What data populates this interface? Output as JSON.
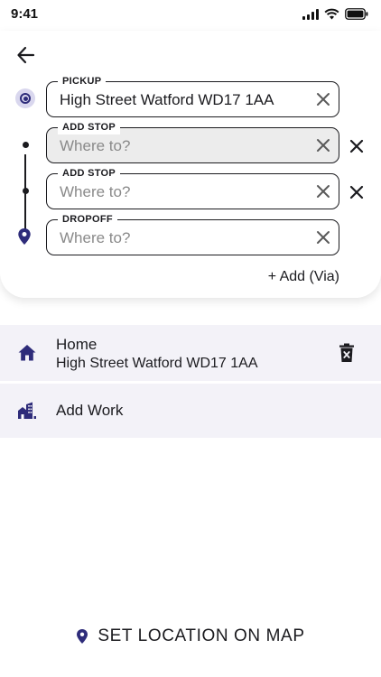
{
  "status_bar": {
    "time": "9:41"
  },
  "route": {
    "pickup": {
      "label": "PICKUP",
      "value": "High Street Watford WD17 1AA",
      "placeholder": "Where to?"
    },
    "stops": [
      {
        "label": "ADD STOP",
        "value": "",
        "placeholder": "Where to?"
      },
      {
        "label": "ADD STOP",
        "value": "",
        "placeholder": "Where to?"
      }
    ],
    "dropoff": {
      "label": "DROPOFF",
      "value": "",
      "placeholder": "Where to?"
    },
    "add_via_label": "+ Add (Via)"
  },
  "saved_places": [
    {
      "title": "Home",
      "subtitle": "High Street Watford WD17 1AA",
      "icon": "home-icon"
    },
    {
      "title": "Add Work",
      "subtitle": "",
      "icon": "work-building-icon"
    }
  ],
  "set_location_label": "SET LOCATION ON MAP",
  "colors": {
    "accent": "#2e2c7a",
    "field_filled_bg": "#ececec",
    "list_bg": "#f3f2f8",
    "text": "#1b1b1f"
  }
}
